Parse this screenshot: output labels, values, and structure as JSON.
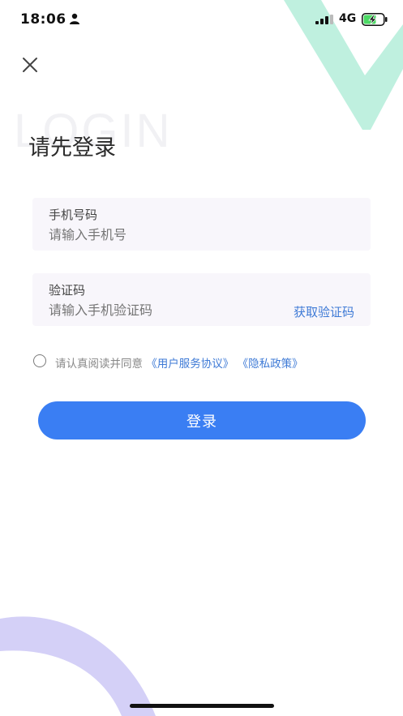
{
  "status_bar": {
    "time": "18:06",
    "network": "4G",
    "person_icon": "person-icon",
    "signal_icon": "signal-icon",
    "battery_icon": "battery-charging-icon"
  },
  "header": {
    "close_icon": "close-icon",
    "watermark": "LOGIN",
    "title": "请先登录"
  },
  "form": {
    "phone": {
      "label": "手机号码",
      "placeholder": "请输入手机号",
      "value": ""
    },
    "code": {
      "label": "验证码",
      "placeholder": "请输入手机验证码",
      "value": "",
      "get_code_label": "获取验证码"
    },
    "agreement": {
      "checked": false,
      "prefix": "请认真阅读并同意",
      "terms_link": "《用户服务协议》",
      "privacy_link": "《隐私政策》"
    },
    "login_label": "登录"
  },
  "colors": {
    "accent": "#3a7ef3",
    "link": "#3e7ad6",
    "decor_top": "#bff0df",
    "decor_bottom": "#d4d0f7",
    "field_bg": "#f8f6fb"
  }
}
